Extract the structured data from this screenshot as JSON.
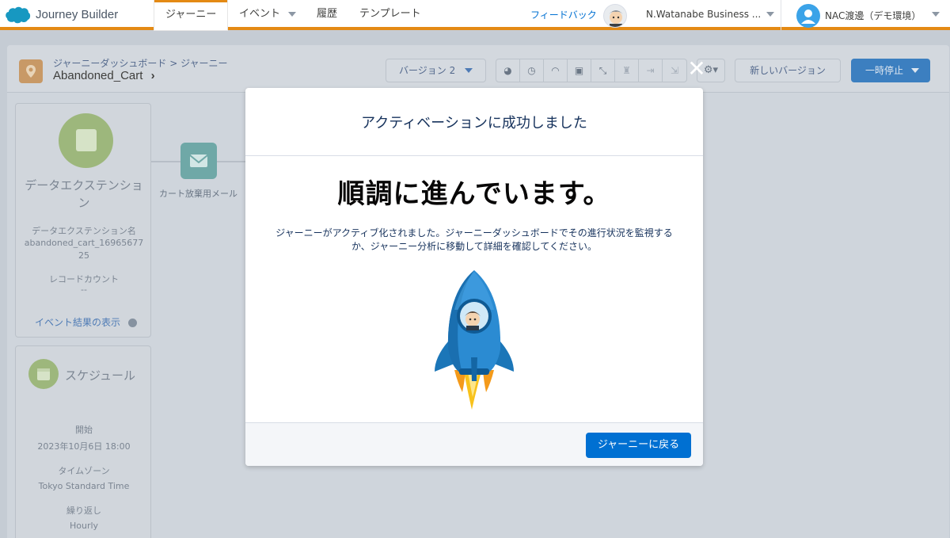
{
  "topnav": {
    "app_name": "Journey Builder",
    "tabs": [
      {
        "label": "ジャーニー",
        "active": true
      },
      {
        "label": "イベント",
        "has_caret": true
      },
      {
        "label": "履歴"
      },
      {
        "label": "テンプレート"
      }
    ],
    "feedback": "フィードバック",
    "business_unit": "N.Watanabe Business ...",
    "account_name": "NAC渡邊（デモ環境）"
  },
  "journey": {
    "breadcrumb": "ジャーニーダッシュボード > ジャーニー",
    "name": "Abandoned_Cart",
    "version": "バージョン 2",
    "new_version": "新しいバージョン",
    "pause": "一時停止",
    "toolbar_icons": [
      "pie-chart-icon",
      "history-icon",
      "gauge-icon",
      "camera-icon",
      "collapse-icon",
      "trophy-icon",
      "exit-icon",
      "export-icon"
    ]
  },
  "entry_source": {
    "title": "データエクステンション",
    "de_name_label": "データエクステンション名",
    "de_name_value": "abandoned_cart_16965677 25",
    "record_count_label": "レコードカウント",
    "record_count_value": "--",
    "event_link": "イベント結果の表示"
  },
  "schedule": {
    "title": "スケジュール",
    "start_label": "開始",
    "start_value": "2023年10月6日 18:00",
    "timezone_label": "タイムゾーン",
    "timezone_value": "Tokyo Standard Time",
    "repeat_label": "繰り返し",
    "repeat_value": "Hourly"
  },
  "activity": {
    "label": "カート放棄用メール"
  },
  "modal": {
    "title": "アクティベーションに成功しました",
    "heading": "順調に進んでいます。",
    "body_line1": "ジャーニーがアクティブ化されました。ジャーニーダッシュボードでその進行状況を監視する",
    "body_line2": "か、ジャーニー分析に移動して詳細を確認してください。",
    "back_button": "ジャーニーに戻る",
    "close_symbol": "✕"
  },
  "colors": {
    "accent_orange": "#e48a14",
    "brand_blue": "#0070d2",
    "entry_green": "#9db77c",
    "email_teal": "#6fa8a7"
  }
}
